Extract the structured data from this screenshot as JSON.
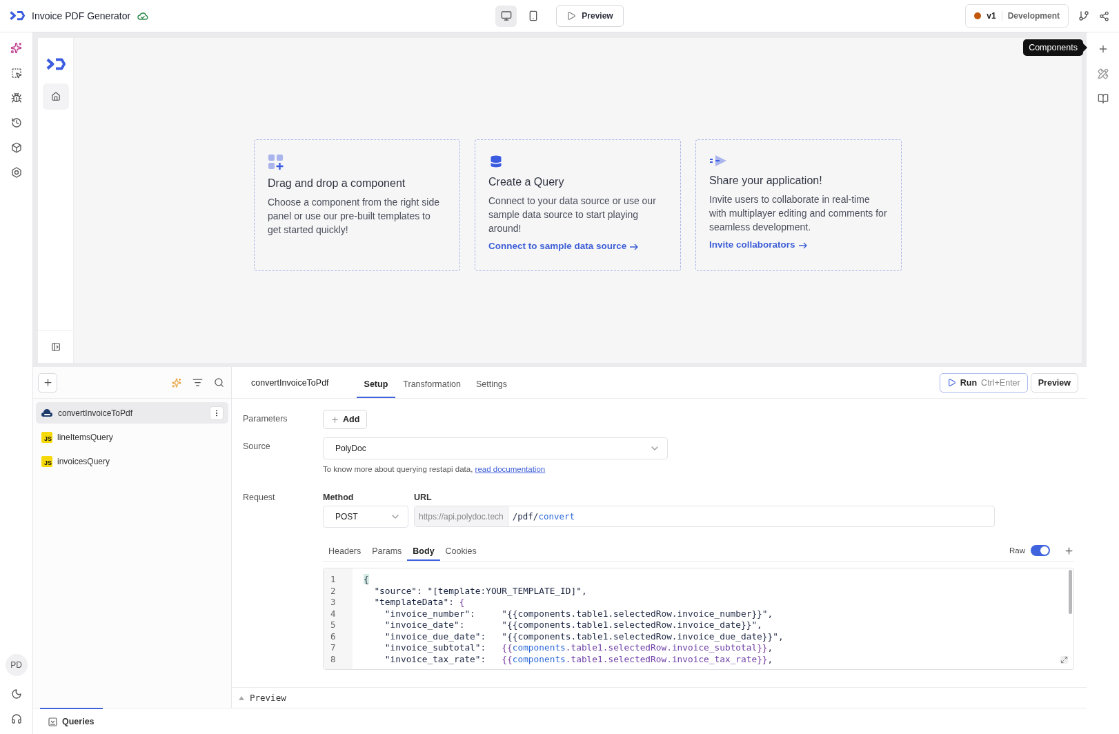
{
  "app": {
    "title": "Invoice PDF Generator"
  },
  "toolbar": {
    "devices": [
      {
        "kind": "desktop",
        "selected": true
      },
      {
        "kind": "mobile",
        "selected": false
      }
    ],
    "preview_label": "Preview"
  },
  "version": {
    "name": "v1",
    "environment": "Development"
  },
  "tooltip": "Components",
  "canvas": {
    "cards": [
      {
        "kind": "component",
        "title": "Drag and drop a component",
        "text": "Choose a component from the right side panel or use our pre-built templates to get started quickly!"
      },
      {
        "kind": "query",
        "title": "Create a Query",
        "text": "Connect to your data source or use our sample data source to start playing around!",
        "link": "Connect to sample data source"
      },
      {
        "kind": "share",
        "title": "Share your application!",
        "text": "Invite users to collaborate in real-time with multiplayer editing and comments for seamless development.",
        "link": "Invite collaborators"
      }
    ]
  },
  "user_initials": "PD",
  "queries": {
    "items": [
      {
        "name": "convertInvoiceToPdf",
        "kind": "restapi",
        "selected": true
      },
      {
        "name": "lineItemsQuery",
        "kind": "js",
        "badge": "JS",
        "selected": false
      },
      {
        "name": "invoicesQuery",
        "kind": "js",
        "badge": "JS",
        "selected": false
      }
    ]
  },
  "editor": {
    "query_name": "convertInvoiceToPdf",
    "tabs": [
      {
        "label": "Setup",
        "selected": true
      },
      {
        "label": "Transformation",
        "selected": false
      },
      {
        "label": "Settings",
        "selected": false
      }
    ],
    "run_label": "Run",
    "run_shortcut": "Ctrl+Enter",
    "preview_label": "Preview",
    "parameters": {
      "label": "Parameters",
      "add_label": "Add"
    },
    "source": {
      "label": "Source",
      "value": "PolyDoc",
      "help": "To know more about querying restapi data,",
      "help_link": "read documentation"
    },
    "request": {
      "label": "Request",
      "method_label": "Method",
      "method": "POST",
      "url_label": "URL",
      "url_base": "https://api.polydoc.tech",
      "url_path": [
        {
          "text": "/pdf/",
          "kind": "key"
        },
        {
          "text": "convert",
          "kind": "ref"
        }
      ]
    },
    "body_tabs": [
      {
        "label": "Headers",
        "selected": false
      },
      {
        "label": "Params",
        "selected": false
      },
      {
        "label": "Body",
        "selected": true
      },
      {
        "label": "Cookies",
        "selected": false
      }
    ],
    "raw": {
      "label": "Raw",
      "on": true
    },
    "code": [
      {
        "number": "1",
        "tokens": [
          {
            "text": "{",
            "kind": "match"
          }
        ]
      },
      {
        "number": "2",
        "tokens": [
          {
            "text": "  \"source\": \"[template:YOUR_TEMPLATE_ID]\",",
            "kind": "key"
          }
        ]
      },
      {
        "number": "3",
        "tokens": [
          {
            "text": "  \"templateData\": ",
            "kind": "key"
          },
          {
            "text": "{",
            "kind": "brace"
          }
        ]
      },
      {
        "number": "4",
        "tokens": [
          {
            "text": "    \"invoice_number\":     \"{{components.table1.selectedRow.invoice_number}}\",",
            "kind": "key"
          }
        ]
      },
      {
        "number": "5",
        "tokens": [
          {
            "text": "    \"invoice_date\":       \"{{components.table1.selectedRow.invoice_date}}\",",
            "kind": "key"
          }
        ]
      },
      {
        "number": "6",
        "tokens": [
          {
            "text": "    \"invoice_due_date\":   \"{{components.table1.selectedRow.invoice_due_date}}\",",
            "kind": "key"
          }
        ]
      },
      {
        "number": "7",
        "tokens": [
          {
            "text": "    \"invoice_subtotal\":   ",
            "kind": "key"
          },
          {
            "text": "{{",
            "kind": "brace"
          },
          {
            "text": "components",
            "kind": "ref"
          },
          {
            "text": ".table1.selectedRow.invoice_subtotal",
            "kind": "path"
          },
          {
            "text": "}}",
            "kind": "brace"
          },
          {
            "text": ",",
            "kind": "key"
          }
        ]
      },
      {
        "number": "8",
        "tokens": [
          {
            "text": "    \"invoice_tax_rate\":   ",
            "kind": "key"
          },
          {
            "text": "{{",
            "kind": "brace"
          },
          {
            "text": "components",
            "kind": "ref"
          },
          {
            "text": ".table1.selectedRow.invoice_tax_rate",
            "kind": "path"
          },
          {
            "text": "}}",
            "kind": "brace"
          },
          {
            "text": ",",
            "kind": "key"
          }
        ]
      }
    ],
    "preview_bar": "Preview"
  },
  "footer": {
    "tabs": [
      {
        "label": "Queries",
        "selected": true
      }
    ]
  }
}
